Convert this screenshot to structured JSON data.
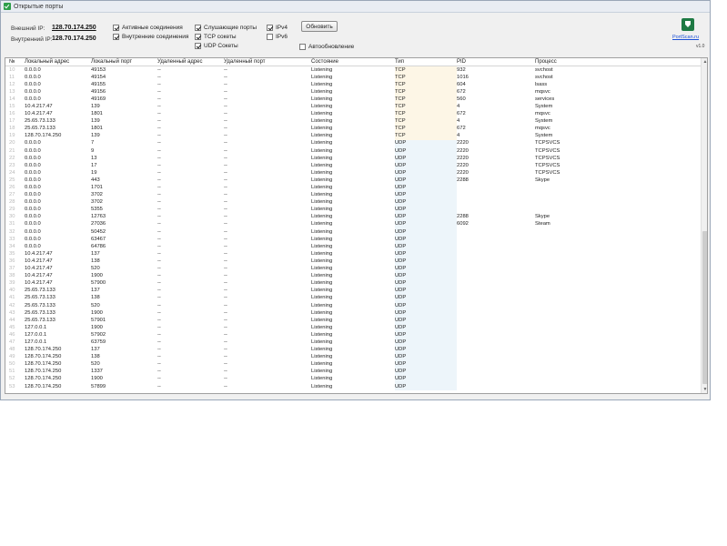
{
  "window": {
    "title": "Открытые порты"
  },
  "header": {
    "external_ip_label": "Внешний IP:",
    "external_ip": "128.70.174.250",
    "internal_ip_label": "Внутренний IP:",
    "internal_ip": "128.70.174.250"
  },
  "filters": {
    "active_connections": {
      "label": "Активные соединения",
      "checked": true
    },
    "internal_connections": {
      "label": "Внутренние соединения",
      "checked": true
    },
    "listening_ports": {
      "label": "Слушающие порты",
      "checked": true
    },
    "tcp_sockets": {
      "label": "TCP сокеты",
      "checked": true
    },
    "udp_sockets": {
      "label": "UDP Сокеты",
      "checked": true
    },
    "ipv4": {
      "label": "IPv4",
      "checked": true
    },
    "ipv6": {
      "label": "IPv6",
      "checked": false
    },
    "auto_update": {
      "label": "Автообновление",
      "checked": false
    }
  },
  "toolbar": {
    "refresh_label": "Обновить"
  },
  "brand": {
    "link": "PortScan.ru",
    "version": "v1.0"
  },
  "colors": {
    "tcp_bg": "#fdf6e6",
    "udp_bg": "#edf5fa",
    "accent": "#1f7a44"
  },
  "table": {
    "columns": [
      "№",
      "Локальный адрес",
      "Локальный порт",
      "Удаленный адрес",
      "Удаленный порт",
      "Состояние",
      "Тип",
      "PID",
      "Процесс"
    ],
    "rows": [
      [
        "10",
        "0.0.0.0",
        "49153",
        "--",
        "--",
        "Listening",
        "TCP",
        "932",
        "svchost"
      ],
      [
        "11",
        "0.0.0.0",
        "49154",
        "--",
        "--",
        "Listening",
        "TCP",
        "1016",
        "svchost"
      ],
      [
        "12",
        "0.0.0.0",
        "49155",
        "--",
        "--",
        "Listening",
        "TCP",
        "604",
        "lsass"
      ],
      [
        "13",
        "0.0.0.0",
        "49156",
        "--",
        "--",
        "Listening",
        "TCP",
        "672",
        "mqsvc"
      ],
      [
        "14",
        "0.0.0.0",
        "49169",
        "--",
        "--",
        "Listening",
        "TCP",
        "560",
        "services"
      ],
      [
        "15",
        "10.4.217.47",
        "139",
        "--",
        "--",
        "Listening",
        "TCP",
        "4",
        "System"
      ],
      [
        "16",
        "10.4.217.47",
        "1801",
        "--",
        "--",
        "Listening",
        "TCP",
        "672",
        "mqsvc"
      ],
      [
        "17",
        "25.65.73.133",
        "139",
        "--",
        "--",
        "Listening",
        "TCP",
        "4",
        "System"
      ],
      [
        "18",
        "25.65.73.133",
        "1801",
        "--",
        "--",
        "Listening",
        "TCP",
        "672",
        "mqsvc"
      ],
      [
        "19",
        "128.70.174.250",
        "139",
        "--",
        "--",
        "Listening",
        "TCP",
        "4",
        "System"
      ],
      [
        "20",
        "0.0.0.0",
        "7",
        "--",
        "--",
        "Listening",
        "UDP",
        "2220",
        "TCPSVCS"
      ],
      [
        "21",
        "0.0.0.0",
        "9",
        "--",
        "--",
        "Listening",
        "UDP",
        "2220",
        "TCPSVCS"
      ],
      [
        "22",
        "0.0.0.0",
        "13",
        "--",
        "--",
        "Listening",
        "UDP",
        "2220",
        "TCPSVCS"
      ],
      [
        "23",
        "0.0.0.0",
        "17",
        "--",
        "--",
        "Listening",
        "UDP",
        "2220",
        "TCPSVCS"
      ],
      [
        "24",
        "0.0.0.0",
        "19",
        "--",
        "--",
        "Listening",
        "UDP",
        "2220",
        "TCPSVCS"
      ],
      [
        "25",
        "0.0.0.0",
        "443",
        "--",
        "--",
        "Listening",
        "UDP",
        "2288",
        "Skype"
      ],
      [
        "26",
        "0.0.0.0",
        "1701",
        "--",
        "--",
        "Listening",
        "UDP",
        "",
        ""
      ],
      [
        "27",
        "0.0.0.0",
        "3702",
        "--",
        "--",
        "Listening",
        "UDP",
        "",
        ""
      ],
      [
        "28",
        "0.0.0.0",
        "3702",
        "--",
        "--",
        "Listening",
        "UDP",
        "",
        ""
      ],
      [
        "29",
        "0.0.0.0",
        "5355",
        "--",
        "--",
        "Listening",
        "UDP",
        "",
        ""
      ],
      [
        "30",
        "0.0.0.0",
        "12763",
        "--",
        "--",
        "Listening",
        "UDP",
        "2288",
        "Skype"
      ],
      [
        "31",
        "0.0.0.0",
        "27036",
        "--",
        "--",
        "Listening",
        "UDP",
        "6092",
        "Steam"
      ],
      [
        "32",
        "0.0.0.0",
        "50452",
        "--",
        "--",
        "Listening",
        "UDP",
        "",
        ""
      ],
      [
        "33",
        "0.0.0.0",
        "63467",
        "--",
        "--",
        "Listening",
        "UDP",
        "",
        ""
      ],
      [
        "34",
        "0.0.0.0",
        "64786",
        "--",
        "--",
        "Listening",
        "UDP",
        "",
        ""
      ],
      [
        "35",
        "10.4.217.47",
        "137",
        "--",
        "--",
        "Listening",
        "UDP",
        "",
        ""
      ],
      [
        "36",
        "10.4.217.47",
        "138",
        "--",
        "--",
        "Listening",
        "UDP",
        "",
        ""
      ],
      [
        "37",
        "10.4.217.47",
        "520",
        "--",
        "--",
        "Listening",
        "UDP",
        "",
        ""
      ],
      [
        "38",
        "10.4.217.47",
        "1900",
        "--",
        "--",
        "Listening",
        "UDP",
        "",
        ""
      ],
      [
        "39",
        "10.4.217.47",
        "57900",
        "--",
        "--",
        "Listening",
        "UDP",
        "",
        ""
      ],
      [
        "40",
        "25.65.73.133",
        "137",
        "--",
        "--",
        "Listening",
        "UDP",
        "",
        ""
      ],
      [
        "41",
        "25.65.73.133",
        "138",
        "--",
        "--",
        "Listening",
        "UDP",
        "",
        ""
      ],
      [
        "42",
        "25.65.73.133",
        "520",
        "--",
        "--",
        "Listening",
        "UDP",
        "",
        ""
      ],
      [
        "43",
        "25.65.73.133",
        "1900",
        "--",
        "--",
        "Listening",
        "UDP",
        "",
        ""
      ],
      [
        "44",
        "25.65.73.133",
        "57901",
        "--",
        "--",
        "Listening",
        "UDP",
        "",
        ""
      ],
      [
        "45",
        "127.0.0.1",
        "1900",
        "--",
        "--",
        "Listening",
        "UDP",
        "",
        ""
      ],
      [
        "46",
        "127.0.0.1",
        "57902",
        "--",
        "--",
        "Listening",
        "UDP",
        "",
        ""
      ],
      [
        "47",
        "127.0.0.1",
        "63759",
        "--",
        "--",
        "Listening",
        "UDP",
        "",
        ""
      ],
      [
        "48",
        "128.70.174.250",
        "137",
        "--",
        "--",
        "Listening",
        "UDP",
        "",
        ""
      ],
      [
        "49",
        "128.70.174.250",
        "138",
        "--",
        "--",
        "Listening",
        "UDP",
        "",
        ""
      ],
      [
        "50",
        "128.70.174.250",
        "520",
        "--",
        "--",
        "Listening",
        "UDP",
        "",
        ""
      ],
      [
        "51",
        "128.70.174.250",
        "1337",
        "--",
        "--",
        "Listening",
        "UDP",
        "",
        ""
      ],
      [
        "52",
        "128.70.174.250",
        "1900",
        "--",
        "--",
        "Listening",
        "UDP",
        "",
        ""
      ],
      [
        "53",
        "128.70.174.250",
        "57899",
        "--",
        "--",
        "Listening",
        "UDP",
        "",
        ""
      ]
    ]
  }
}
